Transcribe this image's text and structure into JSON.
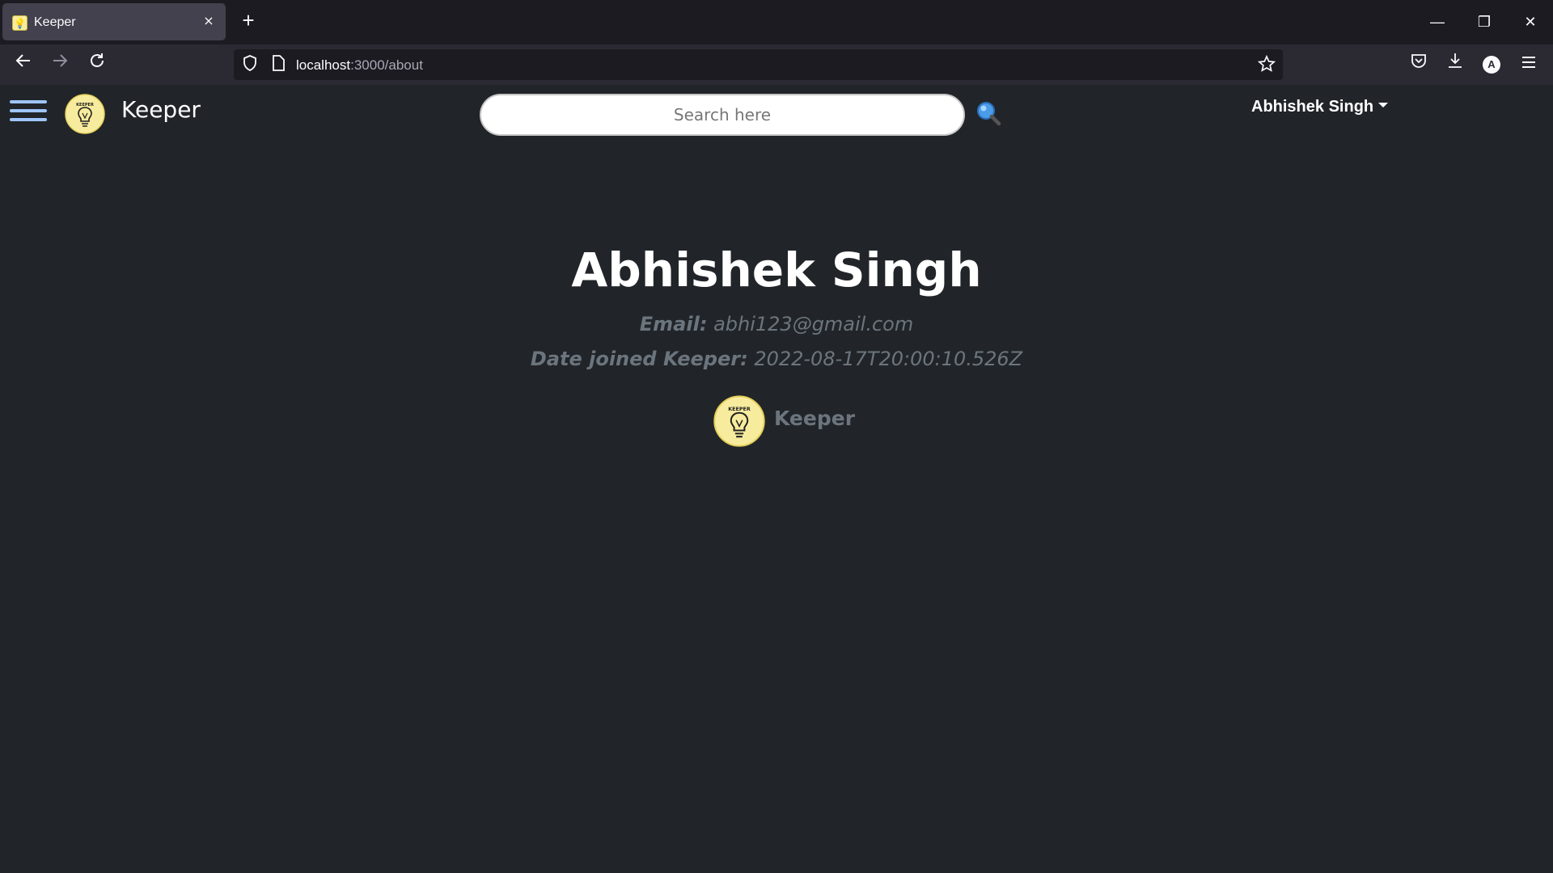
{
  "browser": {
    "tab_title": "Keeper",
    "tab_close": "×",
    "new_tab": "+",
    "url_host": "localhost",
    "url_path": ":3000/about",
    "window_controls": {
      "minimize": "—",
      "restore": "❐",
      "close": "✕"
    }
  },
  "header": {
    "brand_name": "Keeper",
    "search_placeholder": "Search here",
    "user_menu_label": "Abhishek Singh"
  },
  "profile": {
    "name": "Abhishek Singh",
    "email_label": "Email:",
    "email_value": "abhi123@gmail.com",
    "joined_label": "Date joined Keeper:",
    "joined_value": "2022-08-17T20:00:10.526Z"
  },
  "footer": {
    "brand_name": "Keeper"
  },
  "logo_text": "KEEPER",
  "colors": {
    "page_bg": "#212529",
    "muted_text": "#6c757d",
    "hamburger": "#9ec5fe",
    "logo_bg": "#f7ec9e"
  },
  "icons": [
    "bulb-logo-icon",
    "search-icon",
    "hamburger-icon",
    "back-icon",
    "forward-icon",
    "reload-icon",
    "shield-icon",
    "page-icon",
    "star-icon",
    "pocket-icon",
    "download-icon",
    "account-icon",
    "menu-icon",
    "caret-down-icon"
  ]
}
